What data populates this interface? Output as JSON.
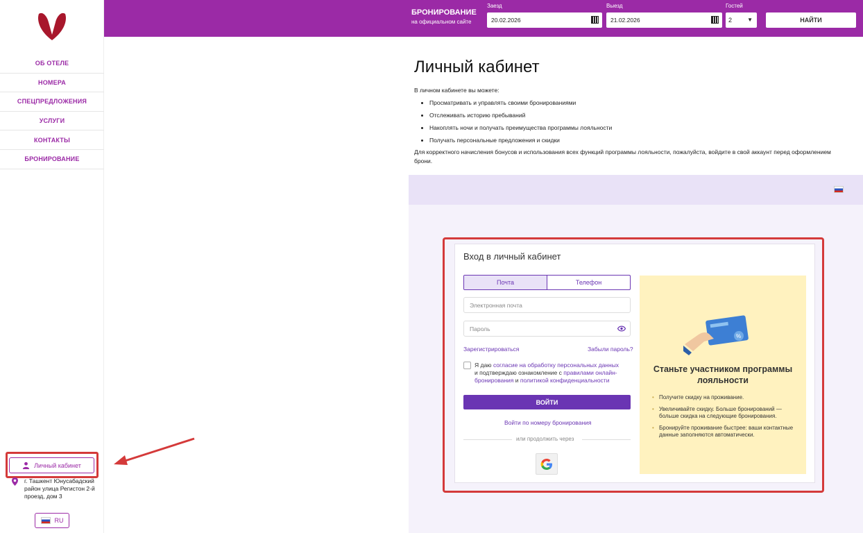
{
  "colors": {
    "brand": "#9b2aa6",
    "accent": "#6a35b3",
    "highlight": "#d43a3a",
    "promo_bg": "#fff2bf"
  },
  "sidebar": {
    "logo_icon": "hotel-logo-icon",
    "items": [
      {
        "label": "ОБ ОТЕЛЕ"
      },
      {
        "label": "НОМЕРА"
      },
      {
        "label": "СПЕЦПРЕДЛОЖЕНИЯ"
      },
      {
        "label": "УСЛУГИ"
      },
      {
        "label": "КОНТАКТЫ"
      },
      {
        "label": "БРОНИРОВАНИЕ"
      }
    ],
    "cabinet_label": "Личный кабинет",
    "address": "г. Ташкент Юнусабадский район улица Регистон 2-й проезд, дом 3",
    "lang": "RU"
  },
  "header": {
    "title": "БРОНИРОВАНИЕ",
    "subtitle": "на официальном сайте",
    "checkin_label": "Заезд",
    "checkin_value": "20.02.2026",
    "checkout_label": "Выезд",
    "checkout_value": "21.02.2026",
    "guests_label": "Гостей",
    "guests_value": "2",
    "find_label": "НАЙТИ"
  },
  "main": {
    "title": "Личный кабинет",
    "intro": "В личном кабинете вы можете:",
    "bullets": [
      "Просматривать и управлять своими бронированиями",
      "Отслеживать историю пребываний",
      "Накоплять ночи и получать преимущества программы лояльности",
      "Получать персональные предложения и скидки"
    ],
    "note": "Для корректного начисления бонусов и использования всех функций программы лояльности, пожалуйста, войдите в свой аккаунт перед оформлением брони."
  },
  "login": {
    "title": "Вход в личный кабинет",
    "tab_email": "Почта",
    "tab_phone": "Телефон",
    "email_placeholder": "Электронная почта",
    "password_placeholder": "Пароль",
    "register": "Зарегистрироваться",
    "forgot": "Забыли пароль?",
    "consent_1": "Я даю ",
    "consent_link1": "согласие на обработку персональных данных",
    "consent_2": " и подтверждаю ознакомление с ",
    "consent_link2": "правилами онлайн-бронирования",
    "consent_3": " и ",
    "consent_link3": "политикой конфиденциальности",
    "login_btn": "ВОЙТИ",
    "booking_login": "Войти по номеру бронирования",
    "or_continue": "или продолжить через"
  },
  "promo": {
    "title": "Станьте участником программы лояльности",
    "items": [
      "Получите скидку на проживание.",
      "Увеличивайте скидку. Больше бронирований — больше скидка на следующие бронирования.",
      "Бронируйте проживание быстрее: ваши контактные данные заполняются автоматически."
    ]
  }
}
